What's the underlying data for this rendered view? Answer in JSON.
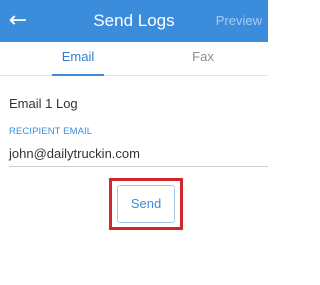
{
  "header": {
    "back_icon": "arrow-left-icon",
    "title": "Send Logs",
    "preview_label": "Preview",
    "background_color": "#3b8ddb"
  },
  "tabs": [
    {
      "label": "Email",
      "active": true
    },
    {
      "label": "Fax",
      "active": false
    }
  ],
  "content": {
    "log_label": "Email 1 Log",
    "recipient_label": "RECIPIENT EMAIL",
    "recipient_value": "john@dailytruckin.com",
    "send_label": "Send",
    "highlight_color": "#d0272d"
  }
}
